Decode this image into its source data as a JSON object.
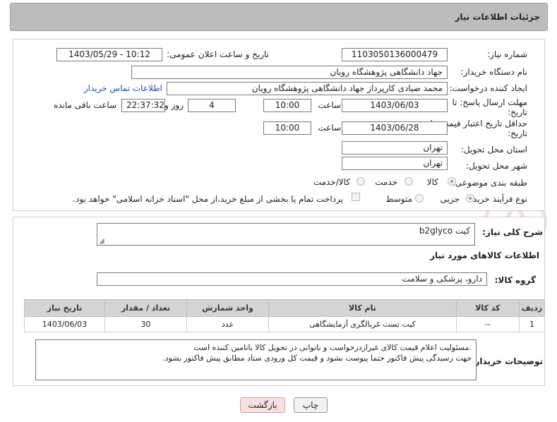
{
  "header": {
    "title": "جزئیات اطلاعات نیاز"
  },
  "form": {
    "need_number_label": "شماره نیاز:",
    "need_number": "1103050136000479",
    "announce_label": "تاریخ و ساعت اعلان عمومی:",
    "announce_value": "1403/05/29 - 10:12",
    "buyer_org_label": "نام دستگاه خریدار:",
    "buyer_org": "جهاد دانشگاهی پژوهشگاه رویان",
    "creator_label": "ایجاد کننده درخواست:",
    "creator": "محمد صیادی کارپرداز جهاد دانشگاهی پژوهشگاه رویان",
    "contact_link": "اطلاعات تماس خریدار",
    "deadline_label_1": "مهلت ارسال پاسخ: تا",
    "deadline_label_2": "تاریخ:",
    "deadline_date": "1403/06/03",
    "time_label": "ساعت",
    "deadline_time": "10:00",
    "days_value": "4",
    "days_label": "روز و",
    "remaining_time": "22:37:32",
    "remaining_label": "ساعت باقی مانده",
    "price_valid_label_1": "حداقل تاریخ اعتبار قیمت: تا",
    "price_valid_label_2": "تاریخ:",
    "price_valid_date": "1403/06/28",
    "price_valid_time_label": "ساعت",
    "price_valid_time": "10:00",
    "province_label": "استان محل تحویل:",
    "province": "تهران",
    "city_label": "شهر محل تحویل:",
    "city": "تهران",
    "category_label": "طبقه بندی موضوعی:",
    "category_options": [
      "کالا",
      "خدمت",
      "کالا/خدمت"
    ],
    "process_label": "نوع فرآیند خرید :",
    "process_options": [
      "جزیی",
      "متوسط"
    ],
    "payment_note": "پرداخت تمام یا بخشی از مبلغ خرید،از محل \"اسناد خزانه اسلامی\" خواهد بود."
  },
  "details": {
    "summary_label": "شرح کلی نیاز:",
    "summary": "کیت b2glyco",
    "goods_info_title": "اطلاعات کالاهای مورد نیاز",
    "goods_group_label": "گروه کالا:",
    "goods_group": "دارو، پزشکی و سلامت"
  },
  "table": {
    "headers": [
      "ردیف",
      "کد کالا",
      "نام کالا",
      "واحد شمارش",
      "تعداد / مقدار",
      "تاریخ نیاز"
    ],
    "rows": [
      [
        "1",
        "--",
        "کیت تست غربالگری آزمایشگاهی",
        "عدد",
        "30",
        "1403/06/03"
      ]
    ]
  },
  "notes": {
    "label": "توضیحات خریدار:",
    "line1": ".مسئولیت اعلام قیمت کالای غیرازدرخواست و ناتوانی در تحویل کالا باتامین کننده است",
    "line2": "جهت رسیدگی پیش فاکتور حتما پیوست بشود و قیمت کل ورودی ستاد مطابق پیش فاکتور بشود."
  },
  "buttons": {
    "print": "چاپ",
    "back": "بازگشت"
  },
  "colors": {
    "header_bg": "#bcbcbc",
    "table_header_bg": "#d4d4d4",
    "back_button_bg": "#f9e1e1",
    "link": "#1f53a8"
  }
}
